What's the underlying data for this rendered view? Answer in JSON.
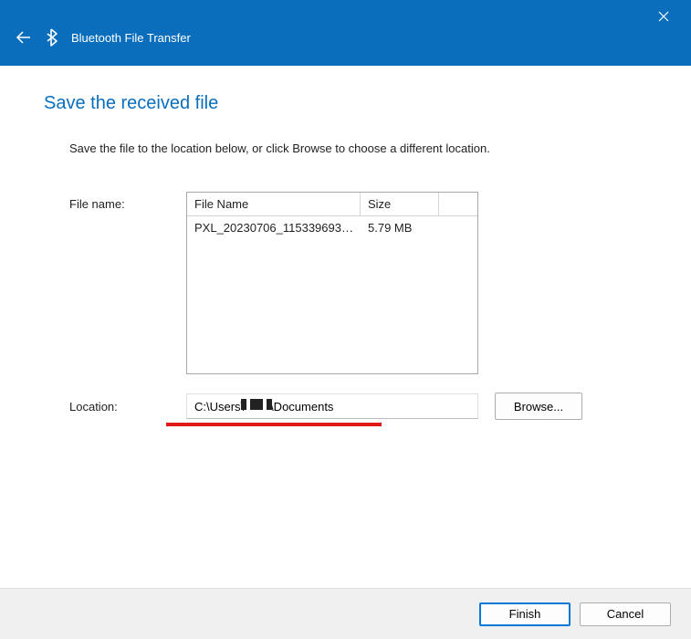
{
  "titlebar": {
    "title": "Bluetooth File Transfer"
  },
  "heading": "Save the received file",
  "description": "Save the file to the location below, or click Browse to choose a different location.",
  "filename_section": {
    "label": "File name:",
    "columns": {
      "name": "File Name",
      "size": "Size"
    },
    "rows": [
      {
        "name": "PXL_20230706_115339693....",
        "size": "5.79 MB"
      }
    ]
  },
  "location_section": {
    "label": "Location:",
    "path_prefix": "C:\\Users\\",
    "path_suffix": "\\Documents",
    "browse_label": "Browse..."
  },
  "buttons": {
    "finish": "Finish",
    "cancel": "Cancel"
  }
}
